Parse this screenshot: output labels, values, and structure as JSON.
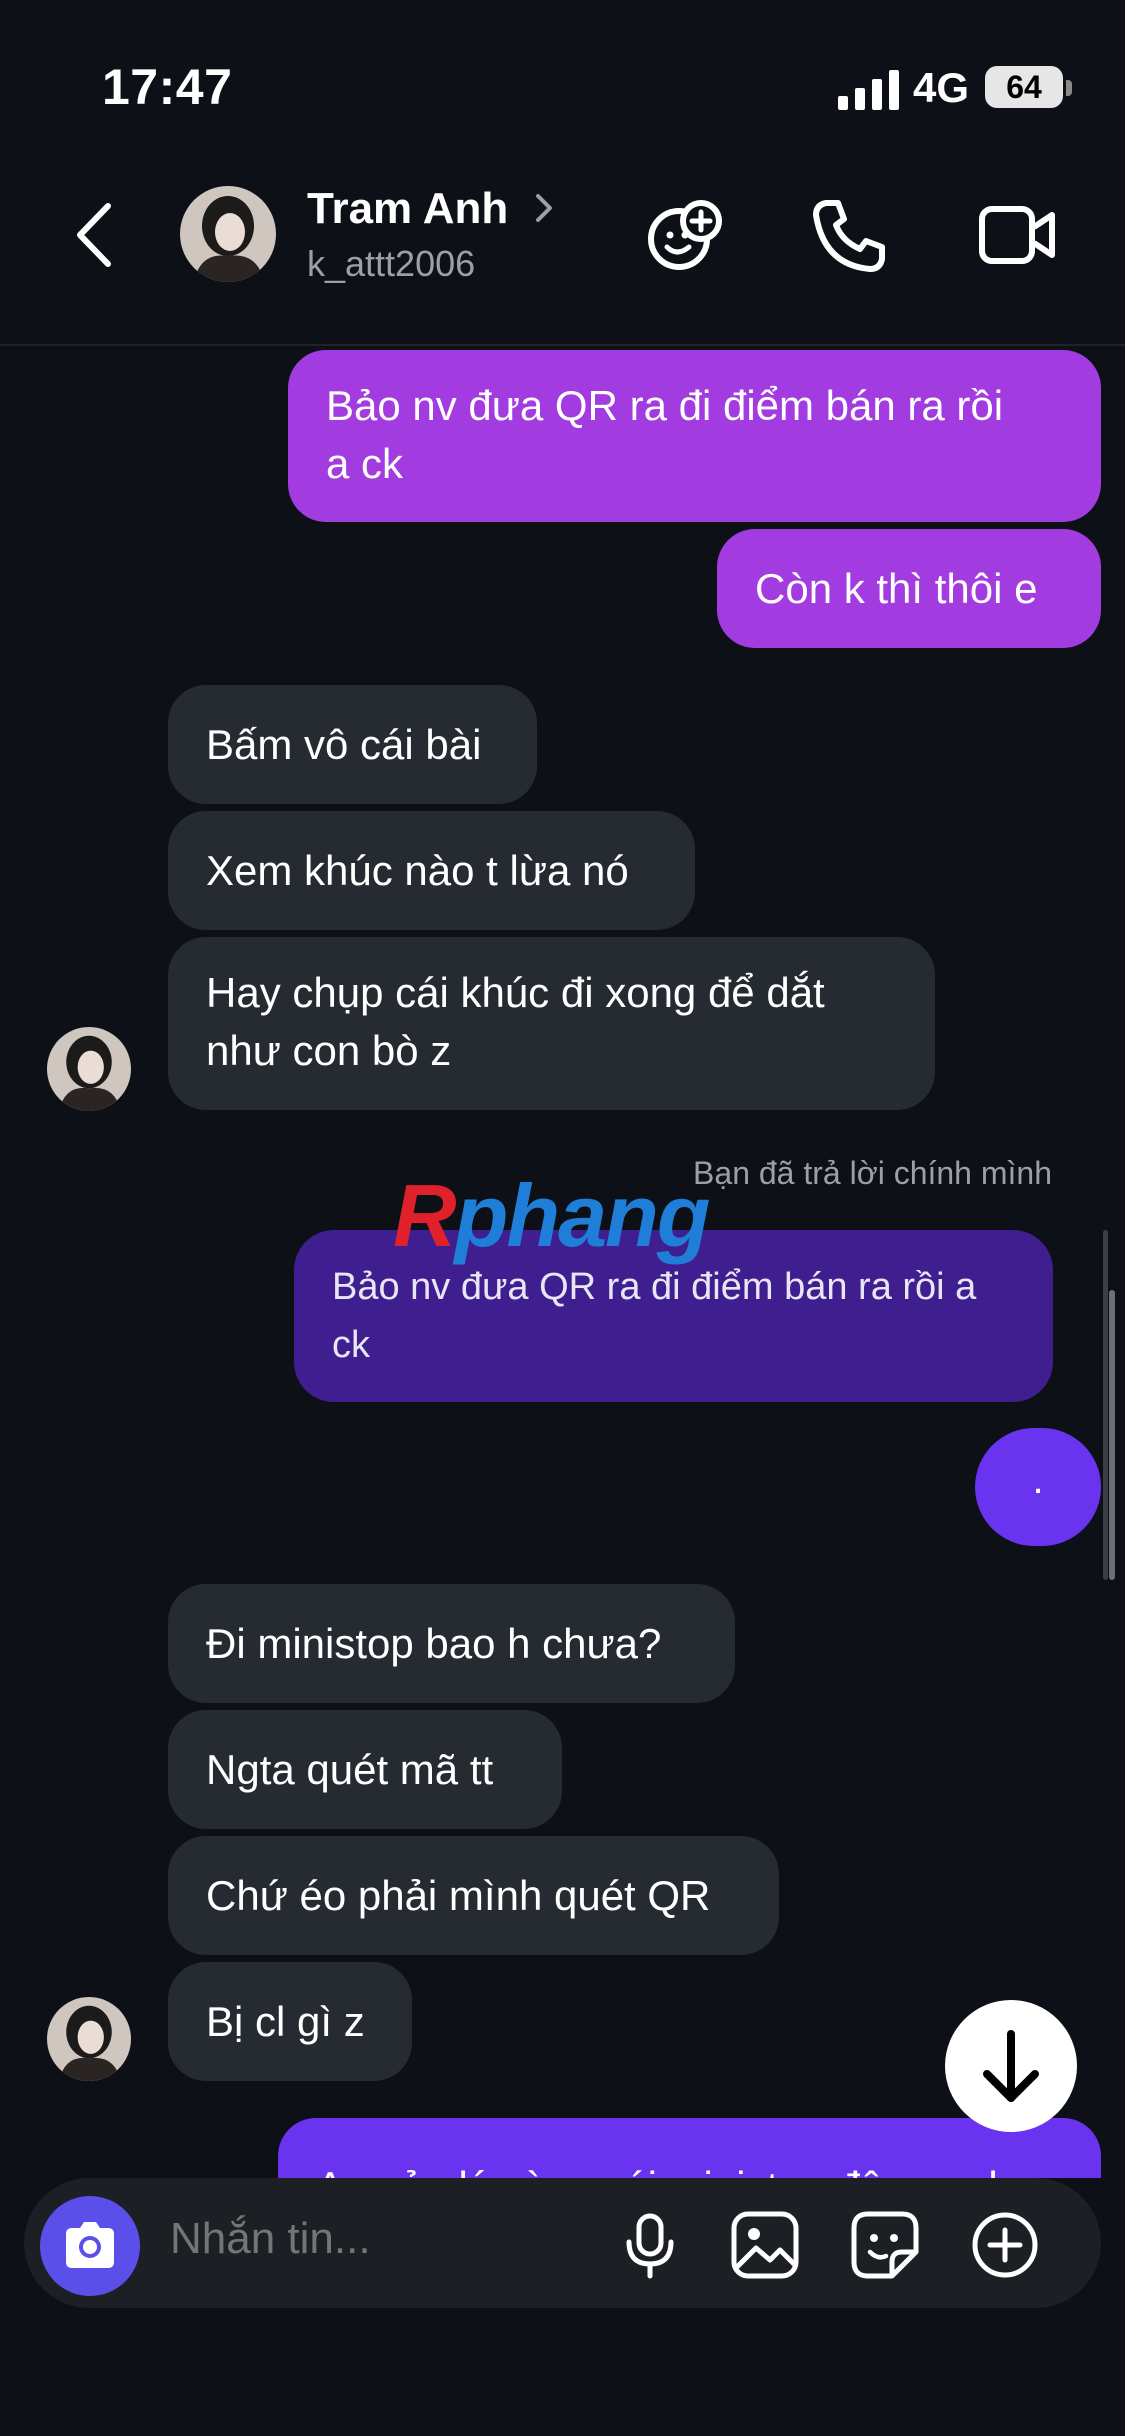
{
  "status_bar": {
    "time": "17:47",
    "network": "4G",
    "battery": "64"
  },
  "header": {
    "name": "Tram Anh",
    "username": "k_attt2006"
  },
  "messages": {
    "out1": [
      "Bảo nv đưa QR ra đi điểm bán ra rồi",
      "a ck"
    ],
    "out2": "Còn k thì thôi e",
    "in1": "Bấm vô cái bài",
    "in2": "Xem khúc nào t lừa nó",
    "in3": [
      "Hay chụp cái khúc đi xong để dắt",
      "như con bò z"
    ],
    "reply_note": "Bạn đã trả lời chính mình",
    "quoted": [
      "Bảo nv đưa QR ra đi điểm bán ra rồi a",
      "ck"
    ],
    "dot": ".",
    "in4": "Đi ministop bao h chưa?",
    "in5": "Ngta quét mã tt",
    "in6": "Chứ éo phải mình quét QR",
    "in7": "Bị cl gì z",
    "out3_partial": "A quản lý vùng cái ministop đây e ad"
  },
  "watermark": {
    "r": "R",
    "rest": "phang"
  },
  "composer": {
    "placeholder": "Nhắn tin..."
  },
  "colors": {
    "outgoing": "#a23ce0",
    "incoming": "#262a31",
    "quoted": "#3f1f8f",
    "camera": "#5b4fe9",
    "background": "#0d1117"
  }
}
